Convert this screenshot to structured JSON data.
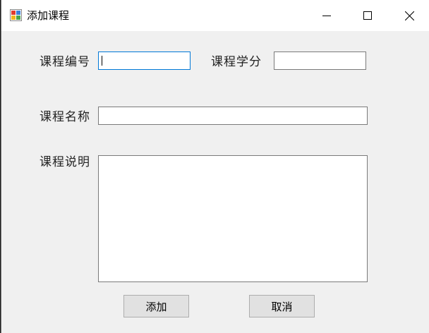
{
  "window": {
    "title": "添加课程",
    "controls": {
      "minimize": "minimize-icon",
      "maximize": "maximize-icon",
      "close": "close-icon"
    }
  },
  "form": {
    "course_id_label": "课程编号",
    "course_id_value": "",
    "credit_label": "课程学分",
    "credit_value": "",
    "course_name_label": "课程名称",
    "course_name_value": "",
    "description_label": "课程说明",
    "description_value": ""
  },
  "buttons": {
    "add_label": "添加",
    "cancel_label": "取消"
  },
  "colors": {
    "title_bg": "#ffffff",
    "body_bg": "#f0f0f0",
    "focus_border": "#0078d7"
  }
}
